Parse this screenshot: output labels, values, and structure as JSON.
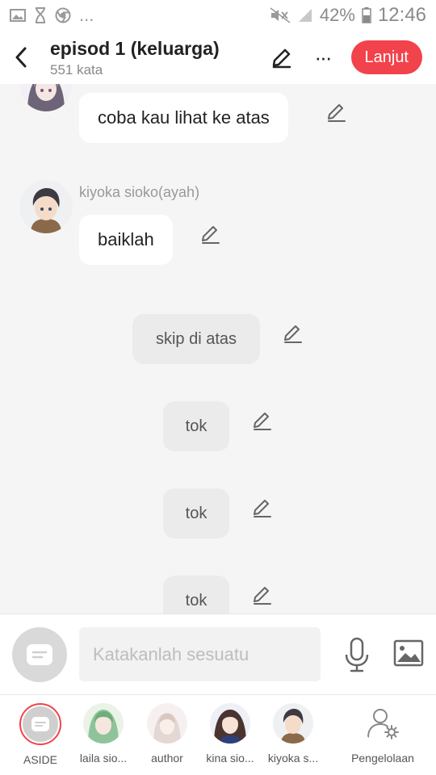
{
  "status_bar": {
    "icons_left": [
      "image-icon",
      "hourglass-icon",
      "chrome-icon"
    ],
    "dots": "...",
    "battery_pct": "42%",
    "time": "12:46"
  },
  "header": {
    "title": "episod 1 (keluarga)",
    "word_count": "551 kata",
    "next_button": "Lanjut",
    "more": "···"
  },
  "chat": {
    "messages": [
      {
        "type": "character",
        "speaker": "",
        "text": "coba kau lihat ke atas"
      },
      {
        "type": "character",
        "speaker": "kiyoka sioko(ayah)",
        "text": "baiklah"
      },
      {
        "type": "narration",
        "text": "skip di atas"
      },
      {
        "type": "narration",
        "text": "tok"
      },
      {
        "type": "narration",
        "text": "tok"
      },
      {
        "type": "narration",
        "text": "tok"
      }
    ]
  },
  "input": {
    "placeholder": "Katakanlah sesuatu"
  },
  "characters": [
    {
      "label": "ASIDE"
    },
    {
      "label": "laila sio..."
    },
    {
      "label": "author"
    },
    {
      "label": "kina sio..."
    },
    {
      "label": "kiyoka s..."
    },
    {
      "label": "Pengelolaan"
    }
  ],
  "colors": {
    "accent": "#f2424b",
    "background": "#f5f5f5",
    "narration_bubble": "#ebebeb"
  }
}
